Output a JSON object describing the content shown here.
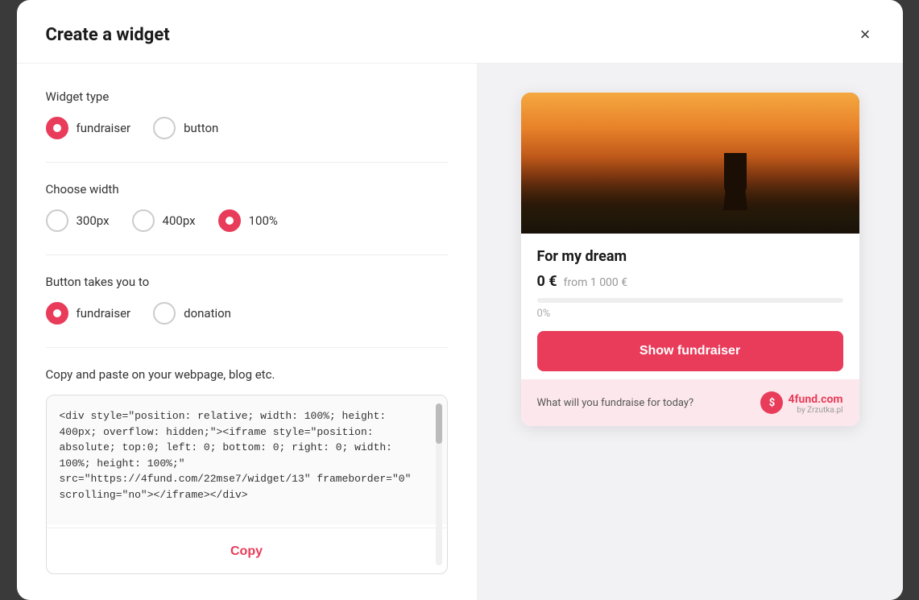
{
  "modal": {
    "title": "Create a widget",
    "close_label": "×"
  },
  "widget_type": {
    "label": "Widget type",
    "options": [
      {
        "id": "fundraiser",
        "label": "fundraiser",
        "selected": true
      },
      {
        "id": "button",
        "label": "button",
        "selected": false
      }
    ]
  },
  "choose_width": {
    "label": "Choose width",
    "options": [
      {
        "id": "300px",
        "label": "300px",
        "selected": false
      },
      {
        "id": "400px",
        "label": "400px",
        "selected": false
      },
      {
        "id": "100pct",
        "label": "100%",
        "selected": true
      }
    ]
  },
  "button_takes_you": {
    "label": "Button takes you to",
    "options": [
      {
        "id": "fundraiser",
        "label": "fundraiser",
        "selected": true
      },
      {
        "id": "donation",
        "label": "donation",
        "selected": false
      }
    ]
  },
  "copy_section": {
    "label": "Copy and paste on your webpage, blog etc.",
    "code": "<div style=\"position: relative; width: 100%; height: 400px; overflow: hidden;\"><iframe style=\"position: absolute; top:0; left: 0; bottom: 0; right: 0; width: 100%; height: 100%;\" src=\"https://4fund.com/22mse7/widget/13\" frameborder=\"0\" scrolling=\"no\"></iframe></div>",
    "copy_button_label": "Copy"
  },
  "preview": {
    "campaign_title": "For my dream",
    "amount": "0 €",
    "from_text": "from 1 000 €",
    "progress_pct": "0%",
    "show_fundraiser_button": "Show fundraiser",
    "footer_text": "What will you fundraise for today?",
    "brand_name": "4fund",
    "brand_tld": ".com",
    "brand_sub": "by Zrzutka.pl"
  }
}
